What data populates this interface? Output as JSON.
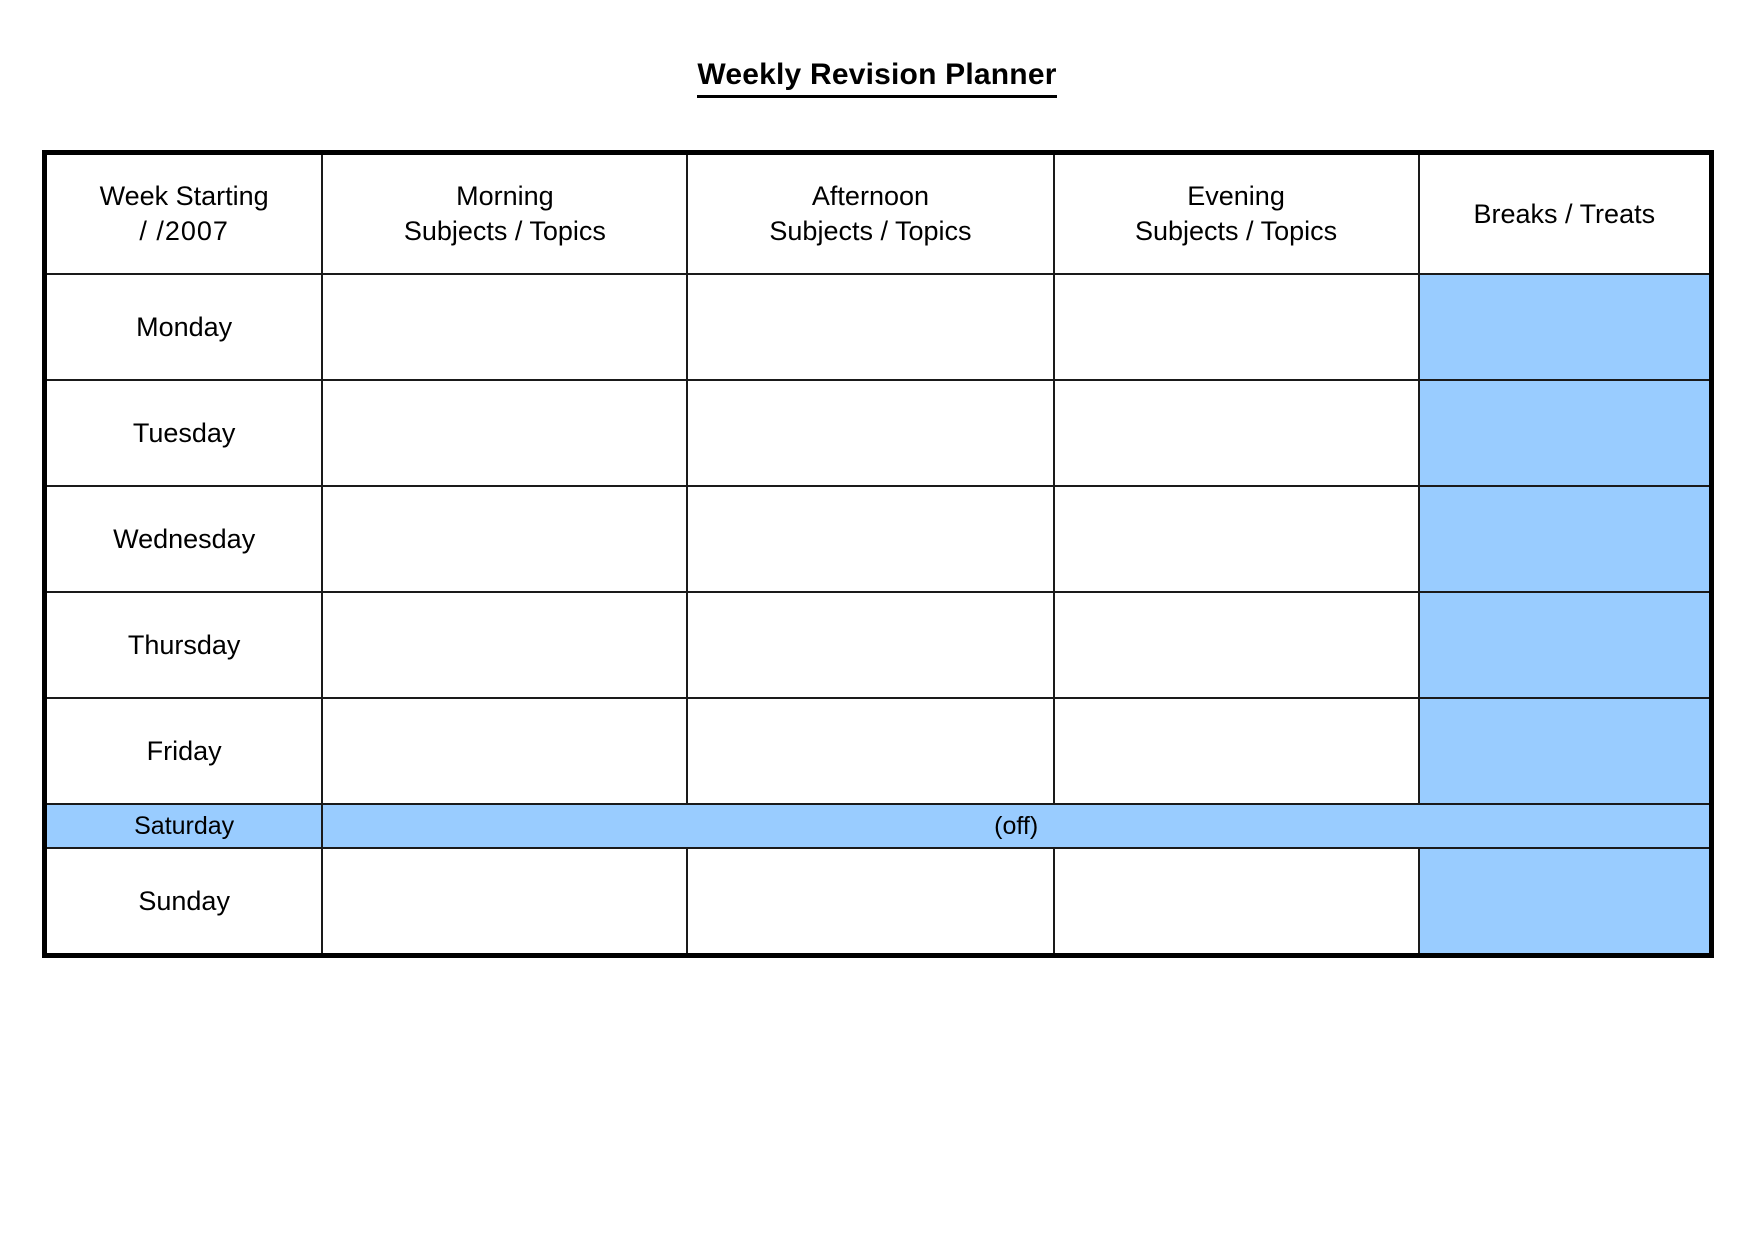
{
  "document": {
    "title": "Weekly Revision Planner"
  },
  "table": {
    "headers": {
      "week_starting_line1": "Week Starting",
      "week_starting_line2": "/    /2007",
      "morning_line1": "Morning",
      "morning_line2": "Subjects / Topics",
      "afternoon_line1": "Afternoon",
      "afternoon_line2": "Subjects / Topics",
      "evening_line1": "Evening",
      "evening_line2": "Subjects / Topics",
      "breaks": "Breaks / Treats"
    },
    "rows": [
      {
        "day": "Monday",
        "color": "#FF99CC",
        "morning": "",
        "afternoon": "",
        "evening": "",
        "breaks": ""
      },
      {
        "day": "Tuesday",
        "color": "#FFCC99",
        "morning": "",
        "afternoon": "",
        "evening": "",
        "breaks": ""
      },
      {
        "day": "Wednesday",
        "color": "#FFFF99",
        "morning": "",
        "afternoon": "",
        "evening": "",
        "breaks": ""
      },
      {
        "day": "Thursday",
        "color": "#CCFFCC",
        "morning": "",
        "afternoon": "",
        "evening": "",
        "breaks": ""
      },
      {
        "day": "Friday",
        "color": "#CCFFFF",
        "morning": "",
        "afternoon": "",
        "evening": "",
        "breaks": ""
      },
      {
        "day": "Sunday",
        "color": "#CC99FF",
        "morning": "",
        "afternoon": "",
        "evening": "",
        "breaks": ""
      }
    ],
    "saturday": {
      "day": "Saturday",
      "color": "#99CCFF",
      "note": "(off)"
    }
  },
  "colors": {
    "monday": "#FF99CC",
    "tuesday": "#FFCC99",
    "wednesday": "#FFFF99",
    "thursday": "#CCFFCC",
    "friday": "#CCFFFF",
    "saturday": "#99CCFF",
    "sunday": "#CC99FF",
    "breaks_column": "#99CCFF",
    "border": "#000000",
    "page_background": "#FFFFFF"
  }
}
